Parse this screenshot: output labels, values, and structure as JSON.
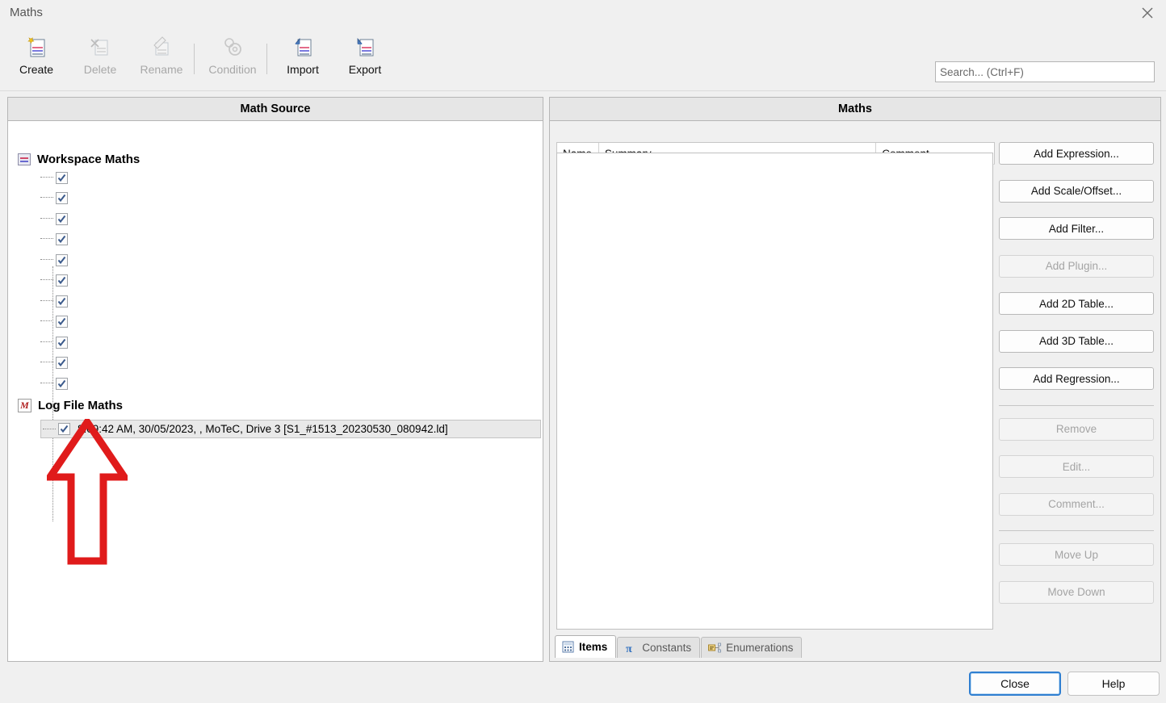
{
  "window": {
    "title": "Maths",
    "close_icon": "close-icon"
  },
  "toolbar": {
    "items": [
      {
        "label": "Create",
        "icon": "create-math-icon",
        "enabled": true
      },
      {
        "label": "Delete",
        "icon": "delete-math-icon",
        "enabled": false
      },
      {
        "label": "Rename",
        "icon": "rename-math-icon",
        "enabled": false
      },
      {
        "label": "Condition",
        "icon": "condition-gear-icon",
        "enabled": false
      },
      {
        "label": "Import",
        "icon": "import-icon",
        "enabled": true
      },
      {
        "label": "Export",
        "icon": "export-icon",
        "enabled": true
      }
    ],
    "search": {
      "placeholder": "Search... (Ctrl+F)",
      "value": ""
    }
  },
  "left_panel": {
    "header": "Math Source",
    "groups": [
      {
        "label": "Workspace Maths",
        "icon": "workspace-maths-icon",
        "children": [
          {
            "label": "",
            "checked": true
          },
          {
            "label": "",
            "checked": true
          },
          {
            "label": "",
            "checked": true
          },
          {
            "label": "",
            "checked": true
          },
          {
            "label": "",
            "checked": true
          },
          {
            "label": "",
            "checked": true
          },
          {
            "label": "",
            "checked": true
          },
          {
            "label": "",
            "checked": true
          },
          {
            "label": "",
            "checked": true
          },
          {
            "label": "",
            "checked": true
          },
          {
            "label": "",
            "checked": true
          }
        ]
      },
      {
        "label": "Log File Maths",
        "icon": "log-file-maths-icon",
        "children": [
          {
            "label": "8:09:42 AM, 30/05/2023, , MoTeC, Drive 3 [S1_#1513_20230530_080942.ld]",
            "checked": true,
            "selected": true
          }
        ]
      }
    ]
  },
  "right_panel": {
    "header": "Maths",
    "columns": [
      {
        "label": "Name"
      },
      {
        "label": "Summary"
      },
      {
        "label": "Comment"
      }
    ],
    "rows": [],
    "buttons": [
      {
        "label": "Add Expression...",
        "enabled": true,
        "mnemonic": ""
      },
      {
        "label": "Add Scale/Offset...",
        "enabled": true,
        "mnemonic": ""
      },
      {
        "label": "Add Filter...",
        "enabled": true,
        "mnemonic": ""
      },
      {
        "label": "Add Plugin...",
        "enabled": false,
        "mnemonic": ""
      },
      {
        "label": "Add 2D Table...",
        "enabled": true,
        "mnemonic": ""
      },
      {
        "label": "Add 3D Table...",
        "enabled": true,
        "mnemonic": ""
      },
      {
        "label": "Add Regression...",
        "enabled": true,
        "mnemonic": ""
      }
    ],
    "buttons2": [
      {
        "label": "Remove",
        "enabled": false,
        "mnemonic": "R"
      },
      {
        "label": "Edit...",
        "enabled": false,
        "mnemonic": "E"
      },
      {
        "label": "Comment...",
        "enabled": false,
        "mnemonic": "C"
      }
    ],
    "buttons3": [
      {
        "label": "Move Up",
        "enabled": false,
        "mnemonic": "U"
      },
      {
        "label": "Move Down",
        "enabled": false,
        "mnemonic": "w"
      }
    ],
    "tabs": [
      {
        "label": "Items",
        "icon": "calculator-icon",
        "active": true
      },
      {
        "label": "Constants",
        "icon": "pi-icon",
        "active": false
      },
      {
        "label": "Enumerations",
        "icon": "enumerations-icon",
        "active": false
      }
    ]
  },
  "footer": {
    "close": "Close",
    "close_mnemonic": "o",
    "help": "Help"
  },
  "annotation": {
    "arrow": "red-up-arrow",
    "color": "#e01b1b"
  },
  "colors": {
    "window_bg": "#f0f0f0",
    "panel_header_bg": "#e6e6e6",
    "accent_focus": "#2f7fd1",
    "annotation_red": "#e01b1b"
  }
}
